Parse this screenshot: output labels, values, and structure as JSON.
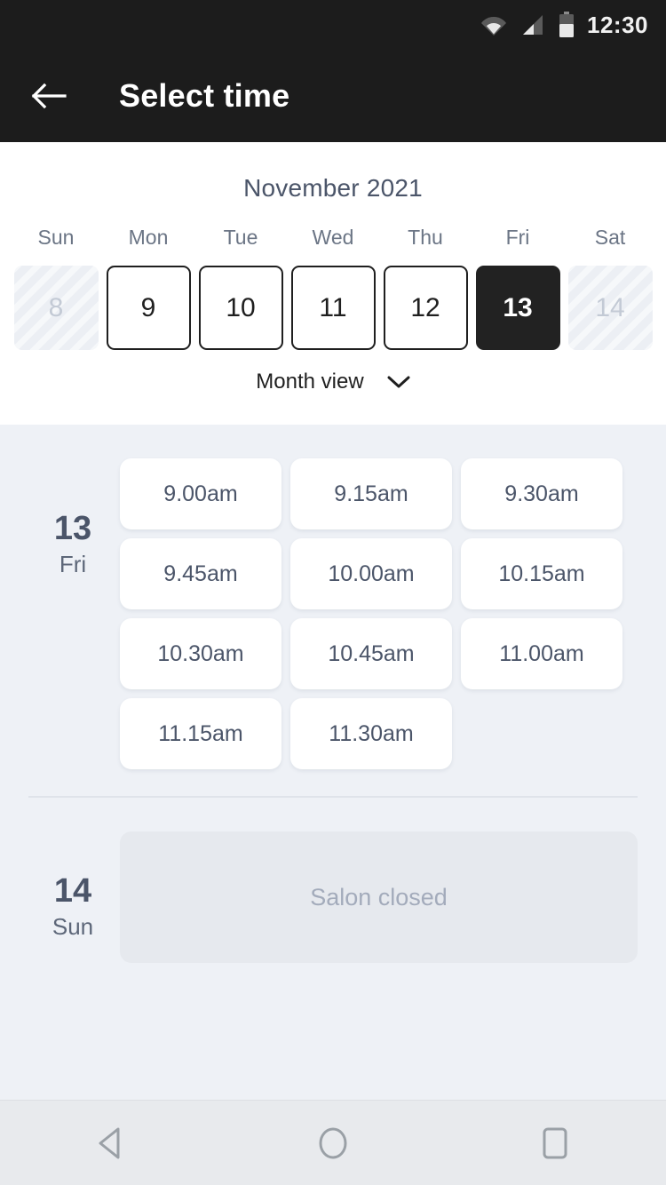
{
  "status_bar": {
    "time": "12:30",
    "icons": [
      "wifi-icon",
      "signal-icon",
      "battery-icon"
    ]
  },
  "app_bar": {
    "back_icon": "back-arrow-icon",
    "title": "Select time"
  },
  "calendar": {
    "month_title": "November 2021",
    "weekdays": [
      "Sun",
      "Mon",
      "Tue",
      "Wed",
      "Thu",
      "Fri",
      "Sat"
    ],
    "days": [
      {
        "num": "8",
        "state": "disabled"
      },
      {
        "num": "9",
        "state": "available"
      },
      {
        "num": "10",
        "state": "available"
      },
      {
        "num": "11",
        "state": "available"
      },
      {
        "num": "12",
        "state": "available"
      },
      {
        "num": "13",
        "state": "selected"
      },
      {
        "num": "14",
        "state": "disabled"
      }
    ],
    "month_view_label": "Month view",
    "month_view_icon": "chevron-down-icon"
  },
  "slots": {
    "groups": [
      {
        "day_number": "13",
        "day_name": "Fri",
        "times": [
          "9.00am",
          "9.15am",
          "9.30am",
          "9.45am",
          "10.00am",
          "10.15am",
          "10.30am",
          "10.45am",
          "11.00am",
          "11.15am",
          "11.30am"
        ]
      },
      {
        "day_number": "14",
        "day_name": "Sun",
        "closed_text": "Salon closed"
      }
    ]
  },
  "nav_bar": {
    "back": "nav-back-icon",
    "home": "nav-home-icon",
    "recents": "nav-recents-icon"
  },
  "colors": {
    "header_bg": "#1c1c1c",
    "selected_day_bg": "#222222",
    "slots_bg": "#eef1f6",
    "slot_card_bg": "#ffffff",
    "text_slate": "#4b5569",
    "closed_card_bg": "#e6e9ee",
    "nav_bg": "#e8eaed"
  }
}
